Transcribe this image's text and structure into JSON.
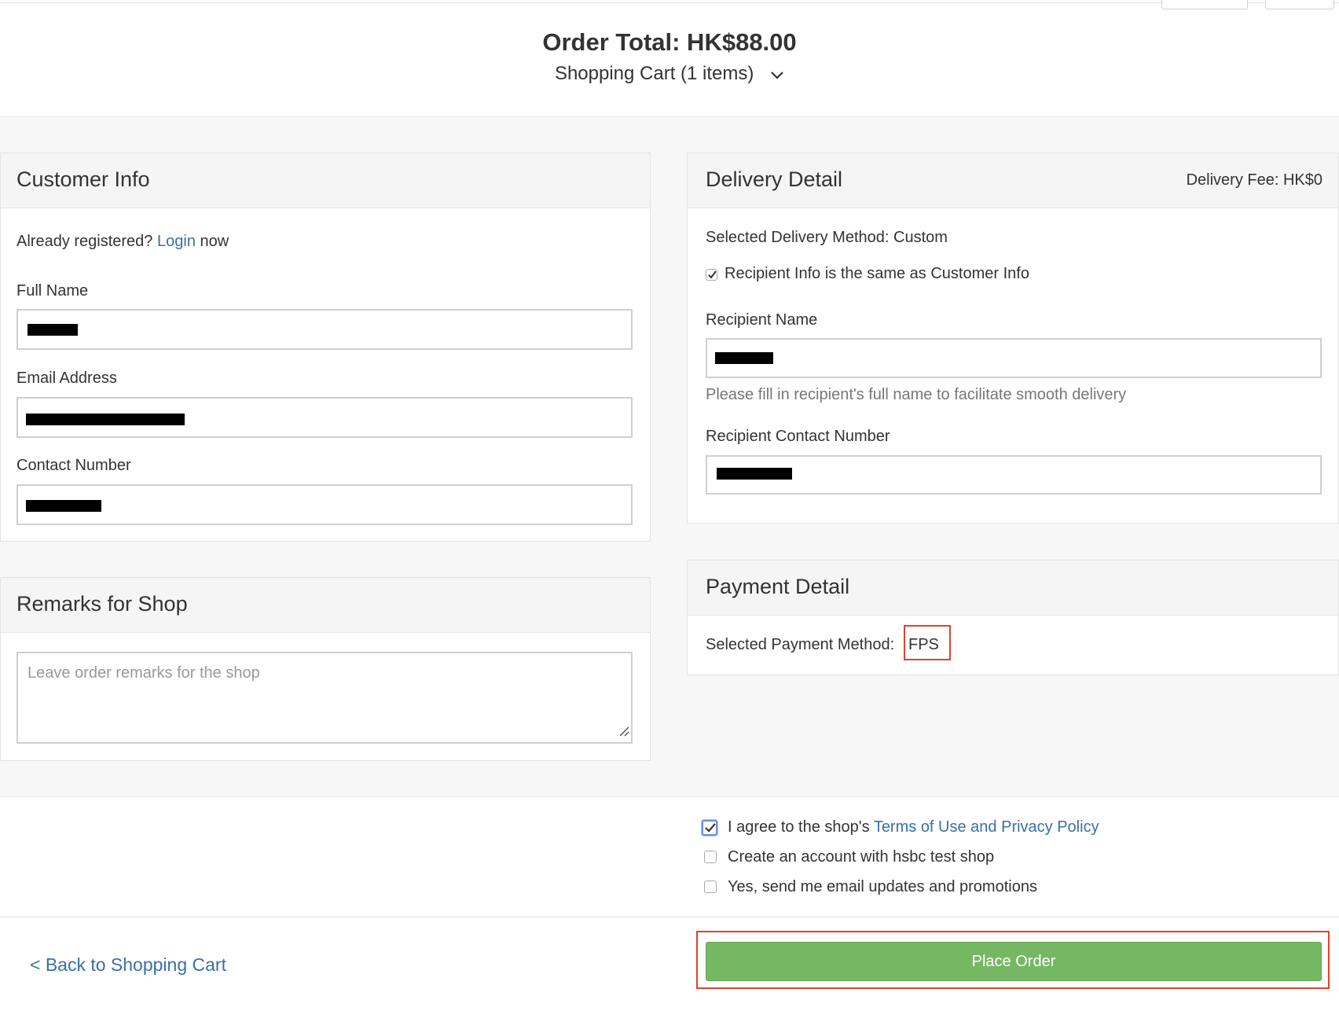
{
  "header": {
    "order_total": "Order Total: HK$88.00",
    "cart_toggle": "Shopping Cart (1 items)"
  },
  "customer_info": {
    "title": "Customer Info",
    "already_registered": "Already registered?",
    "login_link": "Login",
    "now": "now",
    "full_name_label": "Full Name",
    "email_label": "Email Address",
    "contact_label": "Contact Number"
  },
  "remarks": {
    "title": "Remarks for Shop",
    "placeholder": "Leave order remarks for the shop"
  },
  "delivery": {
    "title": "Delivery Detail",
    "fee": "Delivery Fee: HK$0",
    "method": "Selected Delivery Method: Custom",
    "same_as_customer": "Recipient Info is the same as Customer Info",
    "same_as_customer_checked": true,
    "recipient_name_label": "Recipient Name",
    "recipient_name_help": "Please fill in recipient's full name to facilitate smooth delivery",
    "recipient_contact_label": "Recipient Contact Number"
  },
  "payment": {
    "title": "Payment Detail",
    "method_label": "Selected Payment Method:",
    "method_value": "FPS"
  },
  "agreements": {
    "terms_prefix": "I agree to the shop's",
    "terms_link": "Terms of Use and Privacy Policy",
    "terms_checked": true,
    "create_account": "Create an account with hsbc test shop",
    "create_account_checked": false,
    "email_updates": "Yes, send me email updates and promotions",
    "email_updates_checked": false
  },
  "footer": {
    "back_link": "< Back to Shopping Cart",
    "place_order": "Place Order"
  },
  "colors": {
    "link": "#3a6fa8",
    "place_order_bg": "#76b764",
    "highlight_border": "#e0432d"
  }
}
